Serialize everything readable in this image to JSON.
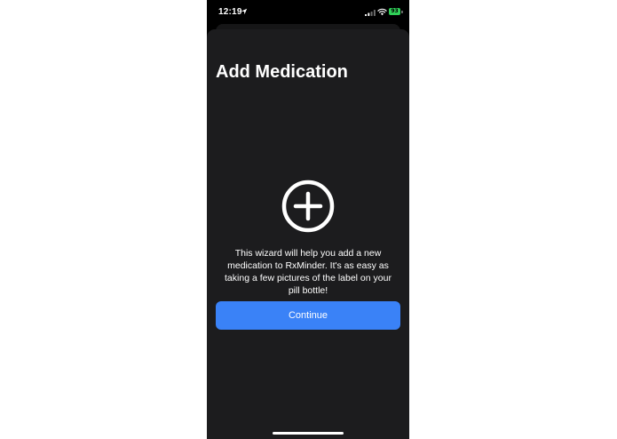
{
  "status_bar": {
    "time": "12:19",
    "battery": "93"
  },
  "screen": {
    "title": "Add Medication",
    "description": "This wizard will help you add a new medication to RxMinder. It's as easy as taking a few pictures of the label on your pill bottle!",
    "continue_label": "Continue"
  },
  "icons": {
    "location": "location-arrow-icon",
    "signal": "cellular-signal-icon",
    "wifi": "wifi-icon",
    "battery": "battery-icon",
    "add": "plus-circle-icon"
  },
  "colors": {
    "sheet_background": "#1c1c1e",
    "accent": "#3a82f7",
    "battery": "#30d158",
    "text": "#ffffff"
  }
}
